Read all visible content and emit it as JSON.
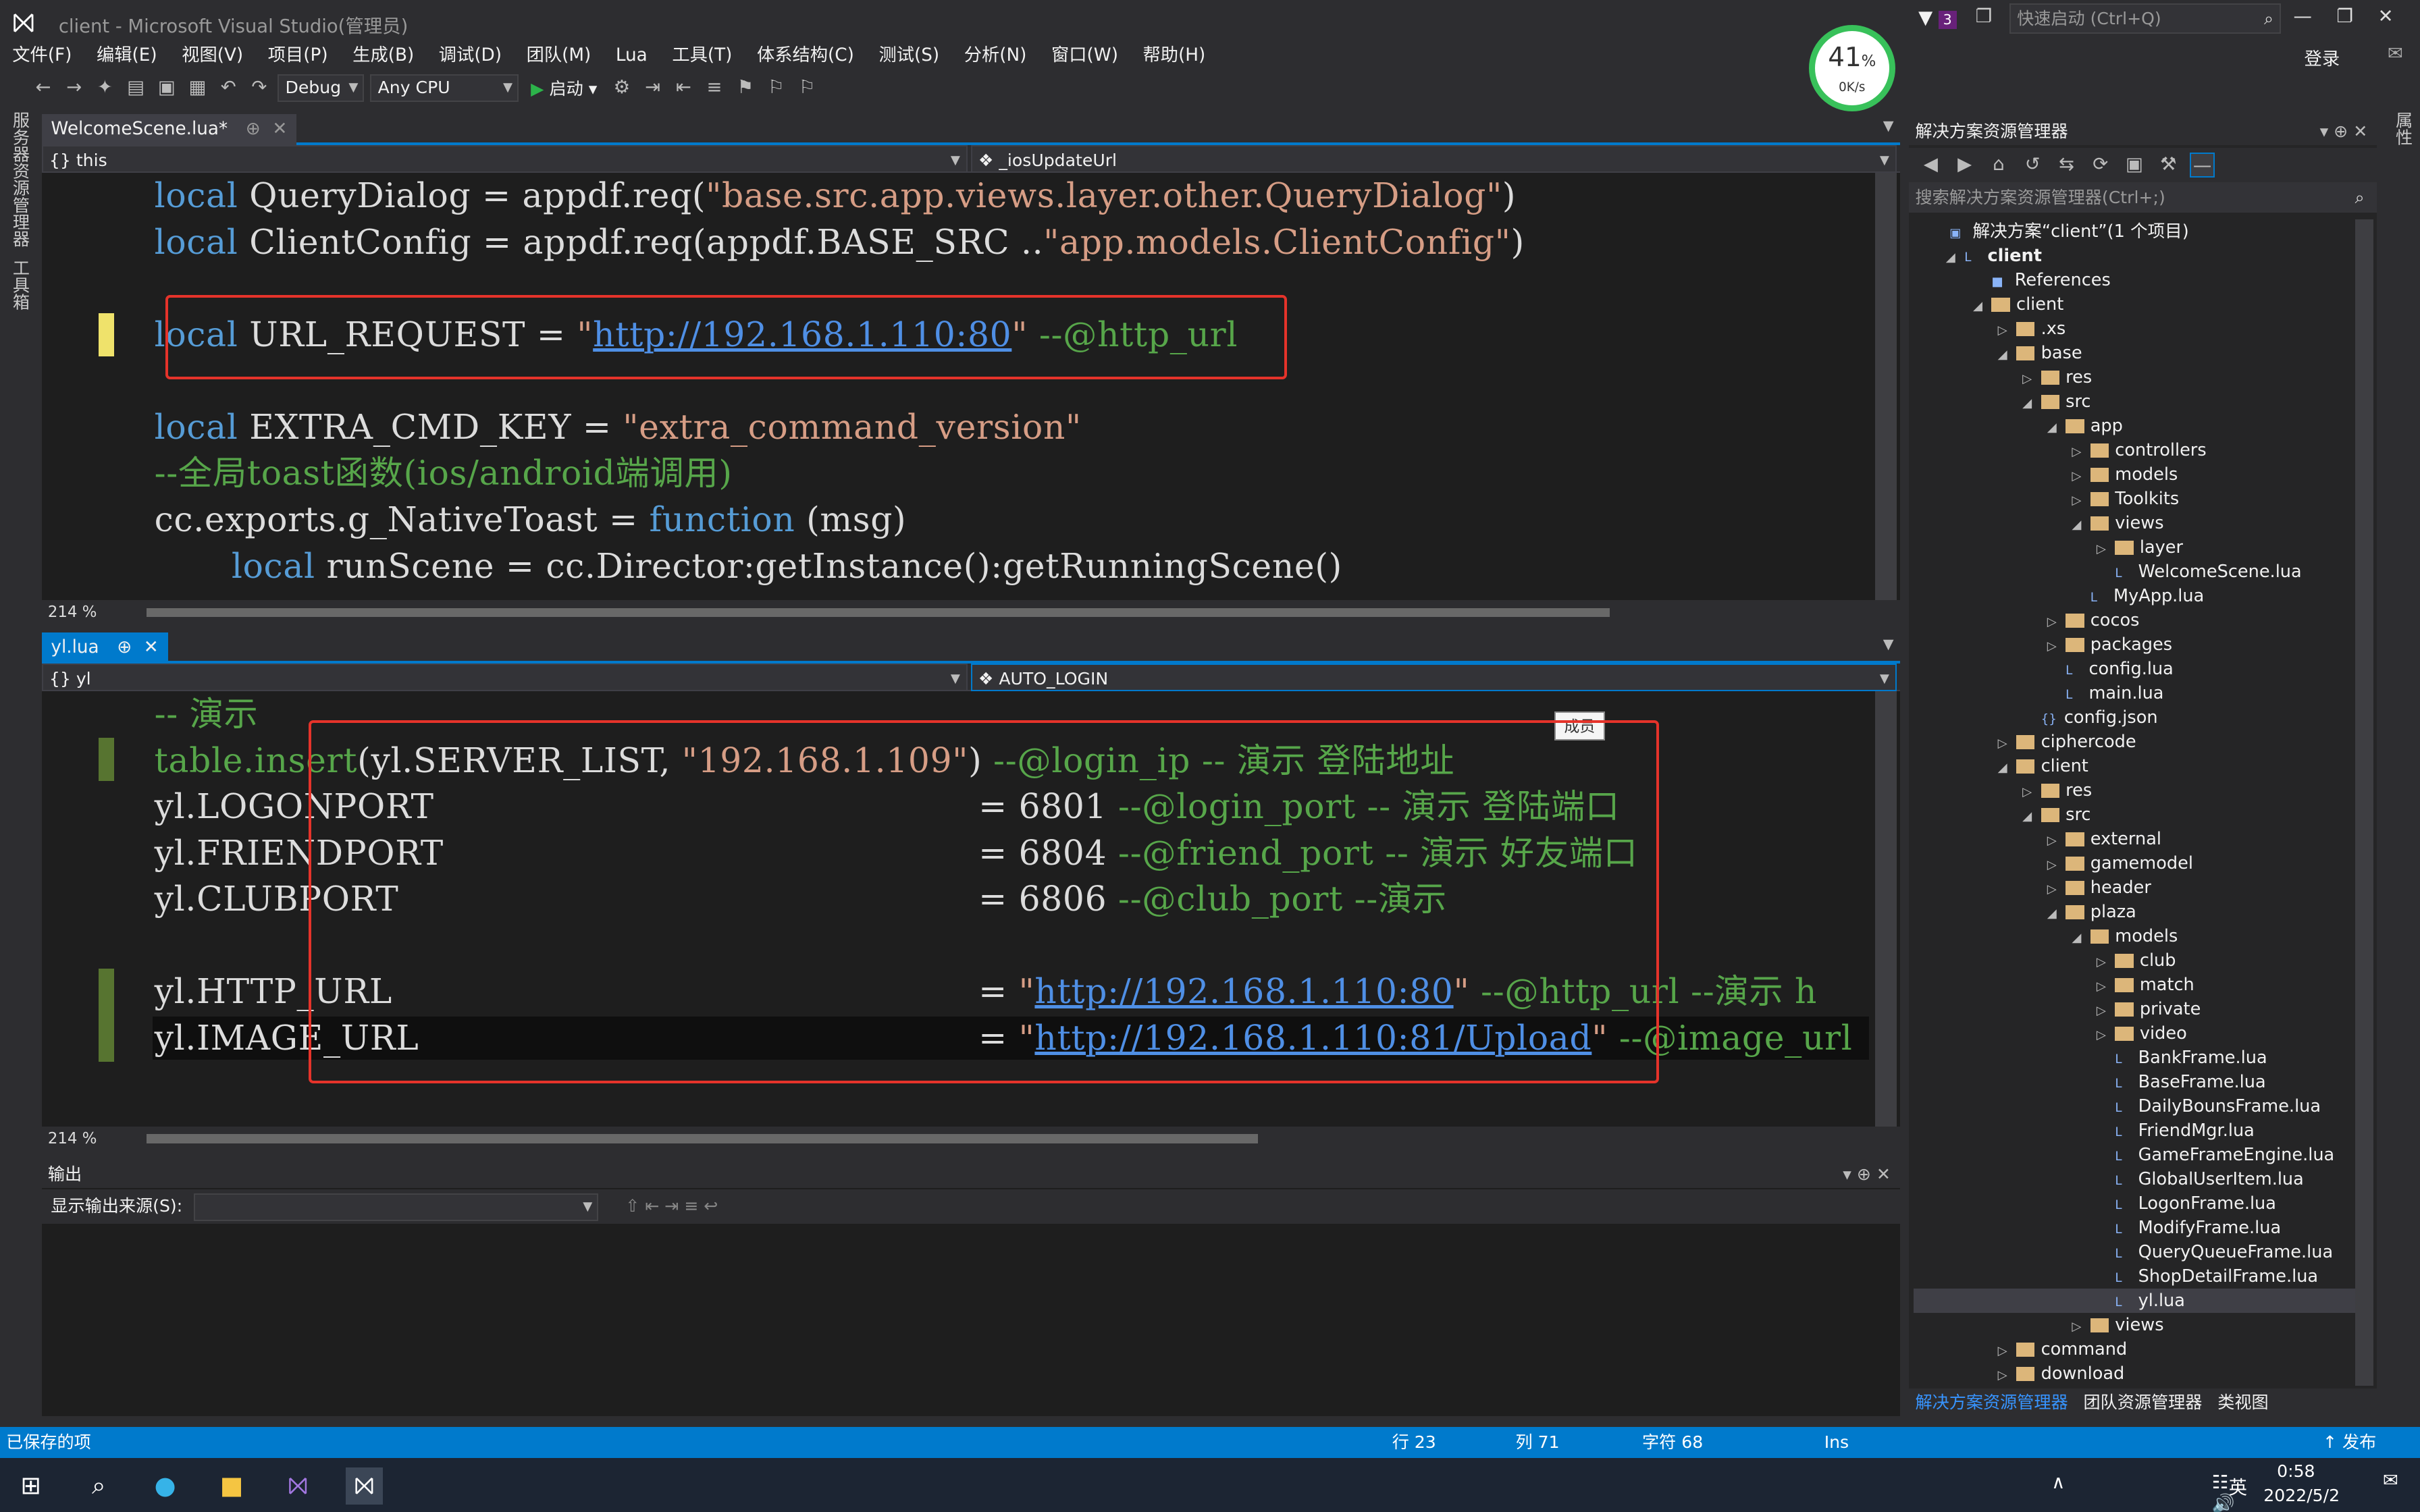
{
  "window": {
    "title": "client - Microsoft Visual Studio(管理员)",
    "notifications": "3",
    "quick_launch_placeholder": "快速启动 (Ctrl+Q)",
    "login": "登录"
  },
  "menu": [
    "文件(F)",
    "编辑(E)",
    "视图(V)",
    "项目(P)",
    "生成(B)",
    "调试(D)",
    "团队(M)",
    "Lua",
    "工具(T)",
    "体系结构(C)",
    "测试(S)",
    "分析(N)",
    "窗口(W)",
    "帮助(H)"
  ],
  "toolbar": {
    "config": "Debug",
    "platform": "Any CPU",
    "start": "启动"
  },
  "perf": {
    "percent": "41",
    "unit": "%",
    "speed": "0K/s"
  },
  "left_dock": [
    "服务器资源管理器",
    "工具箱"
  ],
  "right_dock": [
    "属性"
  ],
  "editor1": {
    "tab": "WelcomeScene.lua*",
    "nav_left": "this",
    "nav_right": "_iosUpdateUrl",
    "zoom": "214 %",
    "lines": {
      "l1_kw": "local",
      "l1_a": " QueryDialog = appdf.req(",
      "l1_s": "\"base.src.app.views.layer.other.QueryDialog\"",
      "l1_b": ")",
      "l2_kw": "local",
      "l2_a": " ClientConfig = appdf.req(appdf.BASE_SRC ..",
      "l2_s": "\"app.models.ClientConfig\"",
      "l2_b": ")",
      "l3_kw": "local",
      "l3_a": " URL_REQUEST = ",
      "l3_q1": "\"",
      "l3_url": "http://192.168.1.110:80",
      "l3_q2": "\"",
      "l3_cm": " --@http_url",
      "l4_kw": "local",
      "l4_a": " EXTRA_CMD_KEY = ",
      "l4_s": "\"extra_command_version\"",
      "l5_cm": "--全局toast函数(ios/android端调用)",
      "l6_a": "cc.exports.g_NativeToast = ",
      "l6_kw": "function",
      "l6_b": " (msg)",
      "l7_kw": "local",
      "l7_a": " runScene = cc.Director:getInstance():getRunningScene()"
    }
  },
  "editor2": {
    "tab": "yl.lua",
    "nav_left": "yl",
    "nav_right": "AUTO_LOGIN",
    "zoom": "214 %",
    "tooltip": "成员",
    "lines": {
      "l1_cm": "-- 演示",
      "l2_a": "table.insert",
      "l2_b": "(yl.SERVER_LIST, ",
      "l2_s": "\"192.168.1.109\"",
      "l2_c": ")",
      "l2_cm": " --@login_ip -- 演示 登陆地址",
      "l3_a": "yl.LOGONPORT",
      "l3_eq": "= 6801",
      "l3_cm": " --@login_port -- 演示 登陆端口",
      "l4_a": "yl.FRIENDPORT",
      "l4_eq": "= 6804",
      "l4_cm": " --@friend_port -- 演示 好友端口",
      "l5_a": "yl.CLUBPORT",
      "l5_eq": "= 6806",
      "l5_cm": " --@club_port --演示",
      "l6_a": "yl.HTTP_URL",
      "l6_eq": "= ",
      "l6_q1": "\"",
      "l6_url": "http://192.168.1.110:80",
      "l6_q2": "\"",
      "l6_cm": " --@http_url --演示 h",
      "l7_a": "yl.IMAGE_URL",
      "l7_eq": "= ",
      "l7_q1": "\"",
      "l7_url": "http://192.168.1.110:81/Upload",
      "l7_q2": "\"",
      "l7_cm": " --@image_url"
    }
  },
  "output": {
    "title": "输出",
    "source_label": "显示输出来源(S):"
  },
  "solution_explorer": {
    "title": "解决方案资源管理器",
    "search": "搜索解决方案资源管理器(Ctrl+;)",
    "items": [
      {
        "label": "解决方案“client”(1 个项目)",
        "kind": "solution"
      },
      {
        "label": "client",
        "kind": "project"
      },
      {
        "label": "References",
        "kind": "ref"
      },
      {
        "label": "client",
        "kind": "folder"
      },
      {
        "label": ".xs",
        "kind": "folder"
      },
      {
        "label": "base",
        "kind": "folder"
      },
      {
        "label": "res",
        "kind": "folder"
      },
      {
        "label": "src",
        "kind": "folder"
      },
      {
        "label": "app",
        "kind": "folder"
      },
      {
        "label": "controllers",
        "kind": "folder"
      },
      {
        "label": "models",
        "kind": "folder"
      },
      {
        "label": "Toolkits",
        "kind": "folder"
      },
      {
        "label": "views",
        "kind": "folder"
      },
      {
        "label": "layer",
        "kind": "folder"
      },
      {
        "label": "WelcomeScene.lua",
        "kind": "lua"
      },
      {
        "label": "MyApp.lua",
        "kind": "lua"
      },
      {
        "label": "cocos",
        "kind": "folder"
      },
      {
        "label": "packages",
        "kind": "folder"
      },
      {
        "label": "config.lua",
        "kind": "lua"
      },
      {
        "label": "main.lua",
        "kind": "lua"
      },
      {
        "label": "config.json",
        "kind": "json"
      },
      {
        "label": "ciphercode",
        "kind": "folder"
      },
      {
        "label": "client",
        "kind": "folder"
      },
      {
        "label": "res",
        "kind": "folder"
      },
      {
        "label": "src",
        "kind": "folder"
      },
      {
        "label": "external",
        "kind": "folder"
      },
      {
        "label": "gamemodel",
        "kind": "folder"
      },
      {
        "label": "header",
        "kind": "folder"
      },
      {
        "label": "plaza",
        "kind": "folder"
      },
      {
        "label": "models",
        "kind": "folder"
      },
      {
        "label": "club",
        "kind": "folder"
      },
      {
        "label": "match",
        "kind": "folder"
      },
      {
        "label": "private",
        "kind": "folder"
      },
      {
        "label": "video",
        "kind": "folder"
      },
      {
        "label": "BankFrame.lua",
        "kind": "lua"
      },
      {
        "label": "BaseFrame.lua",
        "kind": "lua"
      },
      {
        "label": "DailyBounsFrame.lua",
        "kind": "lua"
      },
      {
        "label": "FriendMgr.lua",
        "kind": "lua"
      },
      {
        "label": "GameFrameEngine.lua",
        "kind": "lua"
      },
      {
        "label": "GlobalUserItem.lua",
        "kind": "lua"
      },
      {
        "label": "LogonFrame.lua",
        "kind": "lua"
      },
      {
        "label": "ModifyFrame.lua",
        "kind": "lua"
      },
      {
        "label": "QueryQueueFrame.lua",
        "kind": "lua"
      },
      {
        "label": "ShopDetailFrame.lua",
        "kind": "lua"
      },
      {
        "label": "yl.lua",
        "kind": "lua"
      },
      {
        "label": "views",
        "kind": "folder"
      },
      {
        "label": "command",
        "kind": "folder"
      },
      {
        "label": "download",
        "kind": "folder"
      }
    ],
    "tabs": [
      "解决方案资源管理器",
      "团队资源管理器",
      "类视图"
    ]
  },
  "status": {
    "message": "已保存的项",
    "line": "行 23",
    "col": "列 71",
    "char": "字符 68",
    "mode": "Ins",
    "publish": "发布"
  },
  "taskbar": {
    "ime": "英",
    "time": "0:58",
    "date": "2022/5/2"
  }
}
